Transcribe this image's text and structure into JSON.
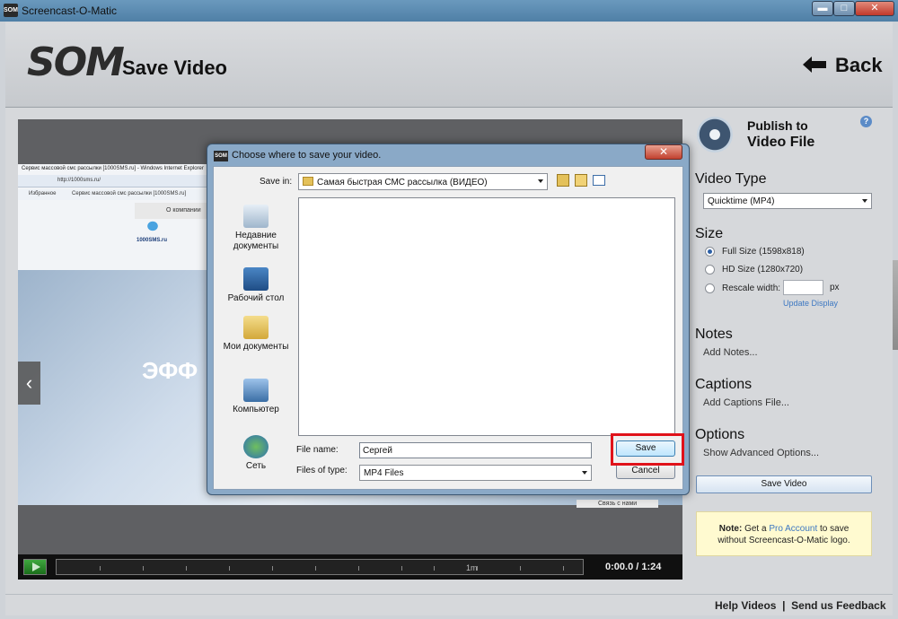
{
  "window": {
    "title": "Screencast-O-Matic",
    "app_icon": "SOM",
    "min": "▬",
    "max": "□",
    "close": "✕"
  },
  "header": {
    "logo": "SOM",
    "title": "Save Video",
    "back_label": "Back"
  },
  "preview": {
    "ie_title": "Сервис массовой смс рассылки [1000SMS.ru] - Windows Internet Explorer",
    "address": "http://1000sms.ru/",
    "favorites": "Избранное",
    "tab": "Сервис массовой смс рассылки [1000SMS.ru]",
    "nav_item": "О компании",
    "site_logo": "1000SMS.ru",
    "hero": "ЭФФ",
    "link": "Связь с нами",
    "prev": "‹"
  },
  "player": {
    "tick_label": "1m",
    "time": "0:00.0 / 1:24"
  },
  "sidebar": {
    "publish_line1": "Publish to",
    "publish_line2": "Video File",
    "help": "?",
    "video_type_title": "Video Type",
    "video_type_value": "Quicktime (MP4)",
    "size_title": "Size",
    "size_options": [
      "Full Size (1598x818)",
      "HD Size (1280x720)",
      "Rescale width:"
    ],
    "px": "px",
    "update_display": "Update Display",
    "notes_title": "Notes",
    "notes_link": "Add Notes...",
    "captions_title": "Captions",
    "captions_link": "Add Captions File...",
    "options_title": "Options",
    "options_link": "Show Advanced Options...",
    "save_button": "Save Video",
    "note_prefix": "Note:",
    "note_text1": " Get a ",
    "note_link": "Pro Account",
    "note_text2": " to save",
    "note_text3": "without Screencast-O-Matic logo."
  },
  "dialog": {
    "title": "Choose where to save your video.",
    "close": "✕",
    "save_in_label": "Save in:",
    "save_in_value": "Самая быстрая СМС рассылка (ВИДЕО)",
    "places": [
      "Недавние документы",
      "Рабочий стол",
      "Мои документы",
      "Компьютер",
      "Сеть"
    ],
    "file_name_label": "File name:",
    "file_name_value": "Сергей",
    "file_type_label": "Files of type:",
    "file_type_value": "MP4 Files",
    "save_button": "Save",
    "cancel_button": "Cancel"
  },
  "footer": {
    "text": "Help Videos  |  Send us Feedback"
  }
}
